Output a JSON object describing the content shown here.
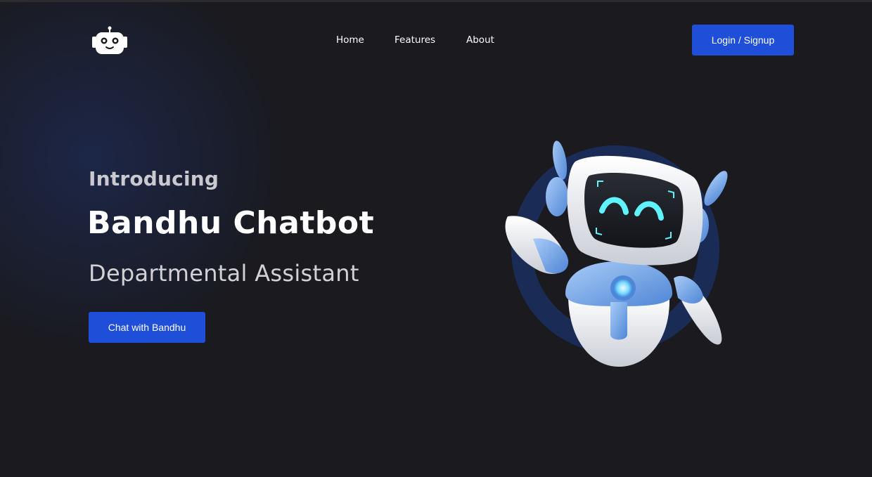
{
  "header": {
    "logo_icon": "robot-face-icon",
    "nav": [
      {
        "label": "Home"
      },
      {
        "label": "Features"
      },
      {
        "label": "About"
      }
    ],
    "login_label": "Login / Signup"
  },
  "hero": {
    "intro": "Introducing",
    "title": "Bandhu Chatbot",
    "subtitle": "Departmental Assistant",
    "cta_label": "Chat with Bandhu",
    "illustration_icon": "waving-robot-illustration"
  },
  "colors": {
    "background": "#1a1a1f",
    "accent": "#1f4fd8",
    "text_primary": "#ffffff",
    "text_secondary": "#c9c9cf",
    "robot_blue": "#6fa3e8",
    "robot_eye": "#5ff2ff"
  }
}
